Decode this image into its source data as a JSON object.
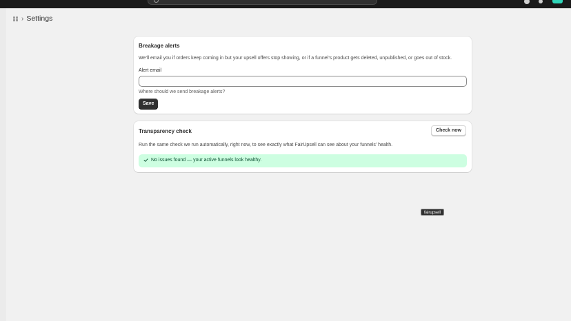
{
  "header": {
    "title": "Settings"
  },
  "breakage_alerts": {
    "title": "Breakage alerts",
    "description": "We’ll email you if orders keep coming in but your upsell offers stop showing, or if a funnel’s product gets deleted, unpublished, or goes out of stock.",
    "email_label": "Alert email",
    "email_value": "",
    "email_help": "Where should we send breakage alerts?",
    "save_label": "Save"
  },
  "transparency_check": {
    "title": "Transparency check",
    "check_label": "Check now",
    "description": "Run the same check we run automatically, right now, to see exactly what FairUpsell can see about your funnels’ health.",
    "status_text": "No issues found — your active funnels look healthy.",
    "status_color": "#cdfee1"
  },
  "tooltip": {
    "text": "fairupsell"
  },
  "colors": {
    "topbar": "#1a1a1a",
    "background": "#f1f1f1",
    "primary_button": "#303030",
    "store_avatar": "#2fd5b8",
    "success_icon": "#0c5132"
  },
  "icons": {
    "search": "search-icon",
    "bell": "bell-icon",
    "help": "help-icon",
    "app": "app-grid-icon",
    "chevron": "chevron-right-icon",
    "success": "checkmark-icon"
  }
}
